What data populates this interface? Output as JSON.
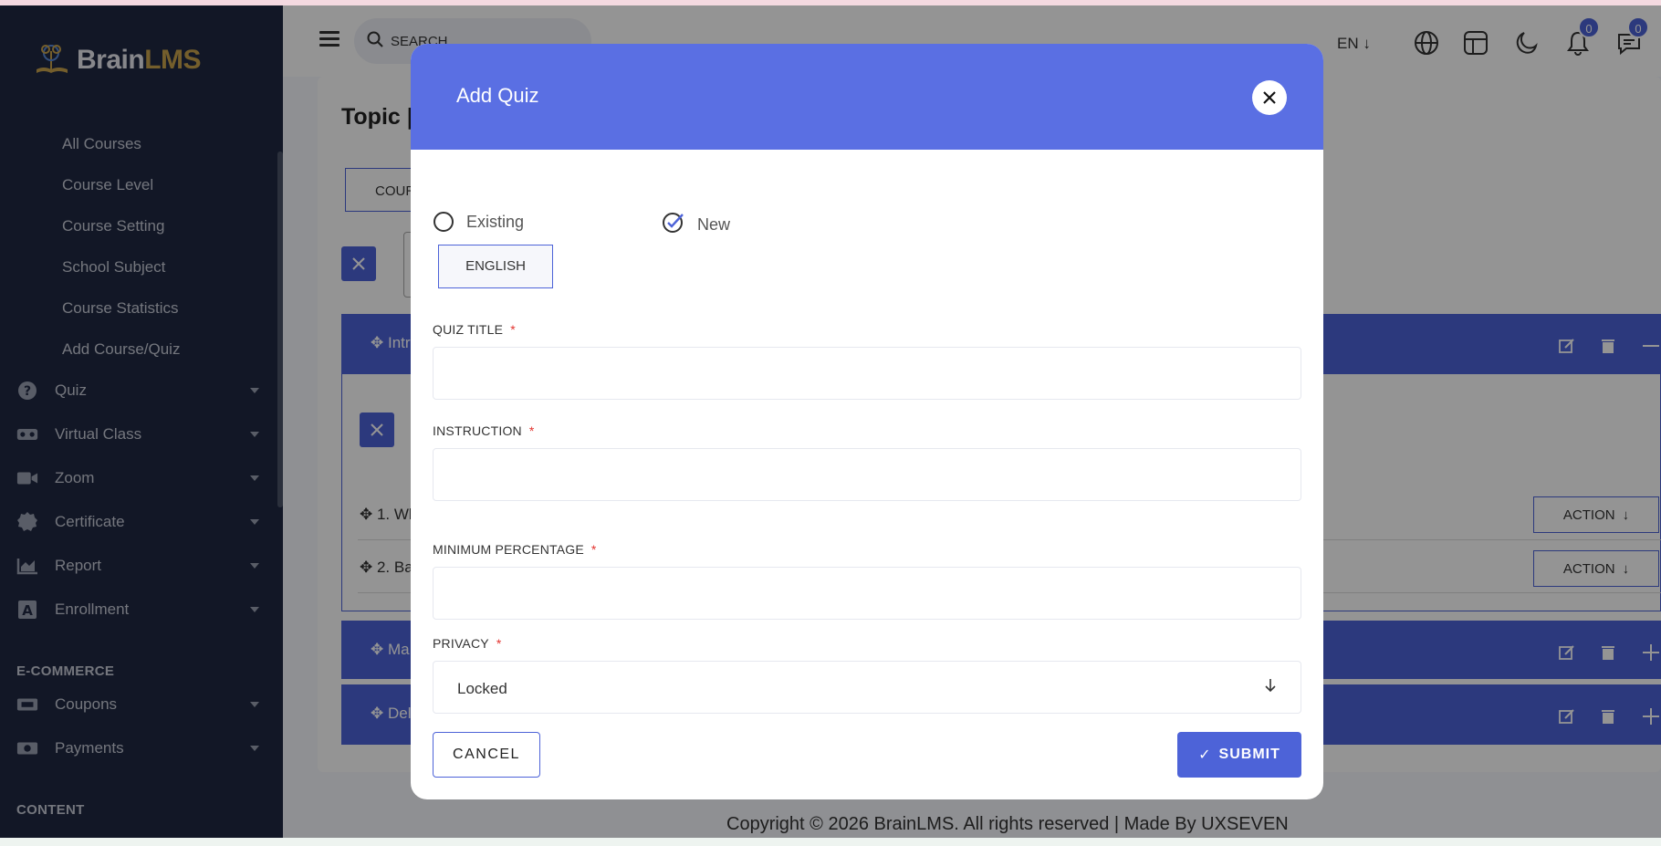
{
  "app": {
    "logo_part1": "Brain",
    "logo_part2": "LMS"
  },
  "sidebar": {
    "sub_items": [
      "All Courses",
      "Course Level",
      "Course Setting",
      "School Subject",
      "Course Statistics",
      "Add Course/Quiz"
    ],
    "menu_items": [
      {
        "label": "Quiz",
        "icon": "question-circle-icon"
      },
      {
        "label": "Virtual Class",
        "icon": "vr-headset-icon"
      },
      {
        "label": "Zoom",
        "icon": "video-camera-icon"
      },
      {
        "label": "Certificate",
        "icon": "certificate-icon"
      },
      {
        "label": "Report",
        "icon": "chart-area-icon"
      },
      {
        "label": "Enrollment",
        "icon": "enrollment-icon"
      }
    ],
    "section_ecommerce": "E-COMMERCE",
    "ecommerce_items": [
      {
        "label": "Coupons",
        "icon": "ticket-icon"
      },
      {
        "label": "Payments",
        "icon": "money-bill-icon"
      }
    ],
    "section_content": "CONTENT"
  },
  "header": {
    "search_placeholder": "SEARCH",
    "language": "EN",
    "notification_count": "0",
    "message_count": "0"
  },
  "main": {
    "page_title": "Topic |",
    "course_tab": "COUR",
    "topics": [
      {
        "label": "Intr"
      },
      {
        "label": "Ma"
      },
      {
        "label": "Del"
      }
    ],
    "questions": [
      {
        "label": "1. Wh",
        "action": "ACTION"
      },
      {
        "label": "2. Ba",
        "action": "ACTION"
      }
    ]
  },
  "footer": {
    "copyright": "Copyright © 2026 BrainLMS. All rights reserved | Made By UXSEVEN"
  },
  "modal": {
    "title": "Add Quiz",
    "radio_existing": "Existing",
    "radio_new": "New",
    "language_tab": "ENGLISH",
    "quiz_title_label": "QUIZ TITLE",
    "instruction_label": "INSTRUCTION",
    "min_percentage_label": "MINIMUM PERCENTAGE",
    "privacy_label": "PRIVACY",
    "required_mark": "*",
    "privacy_value": "Locked",
    "cancel_label": "CANCEL",
    "submit_label": "SUBMIT"
  },
  "colors": {
    "primary": "#4d63d8",
    "modal_header": "#5a6fe3",
    "sidebar_bg": "#1f2942",
    "logo_accent": "#c9a24c"
  }
}
